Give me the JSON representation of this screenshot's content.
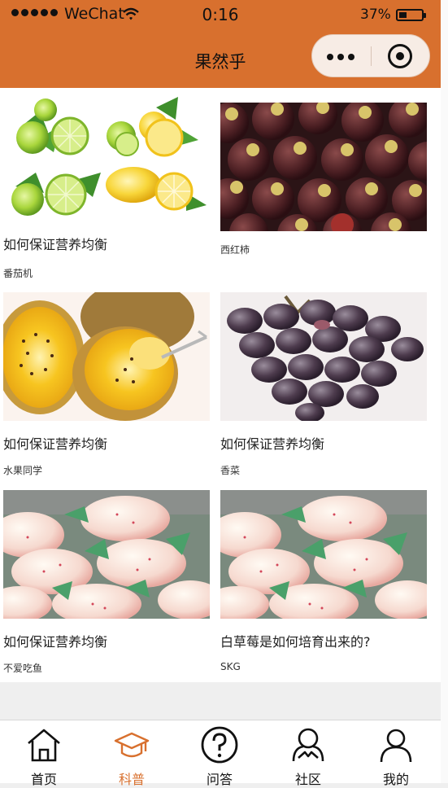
{
  "status_bar": {
    "carrier": "WeChat",
    "time": "0:16",
    "battery": "37%",
    "battery_level": 0.37
  },
  "nav": {
    "title": "果然乎"
  },
  "cards": [
    {
      "title": "如何保证营养均衡",
      "sub": "番茄机",
      "image": "limes-and-lemons"
    },
    {
      "title": "",
      "sub": "西红柿",
      "image": "mangosteens"
    },
    {
      "title": "如何保证营养均衡",
      "sub": "水果同学",
      "image": "golden-kiwi"
    },
    {
      "title": "如何保证营养均衡",
      "sub": "香菜",
      "image": "purple-grapes"
    },
    {
      "title": "如何保证营养均衡",
      "sub": "不爱吃鱼",
      "image": "white-strawberries"
    },
    {
      "title": "白草莓是如何培育出来的?",
      "sub": "SKG",
      "image": "white-strawberries"
    }
  ],
  "tabbar": [
    {
      "label": "首页",
      "icon": "home-icon"
    },
    {
      "label": "科普",
      "icon": "graduation-cap-icon",
      "active": true
    },
    {
      "label": "问答",
      "icon": "question-icon"
    },
    {
      "label": "社区",
      "icon": "community-icon"
    },
    {
      "label": "我的",
      "icon": "user-icon"
    }
  ],
  "colors": {
    "brand": "#d8702e",
    "active_tab": "#d8702e"
  }
}
